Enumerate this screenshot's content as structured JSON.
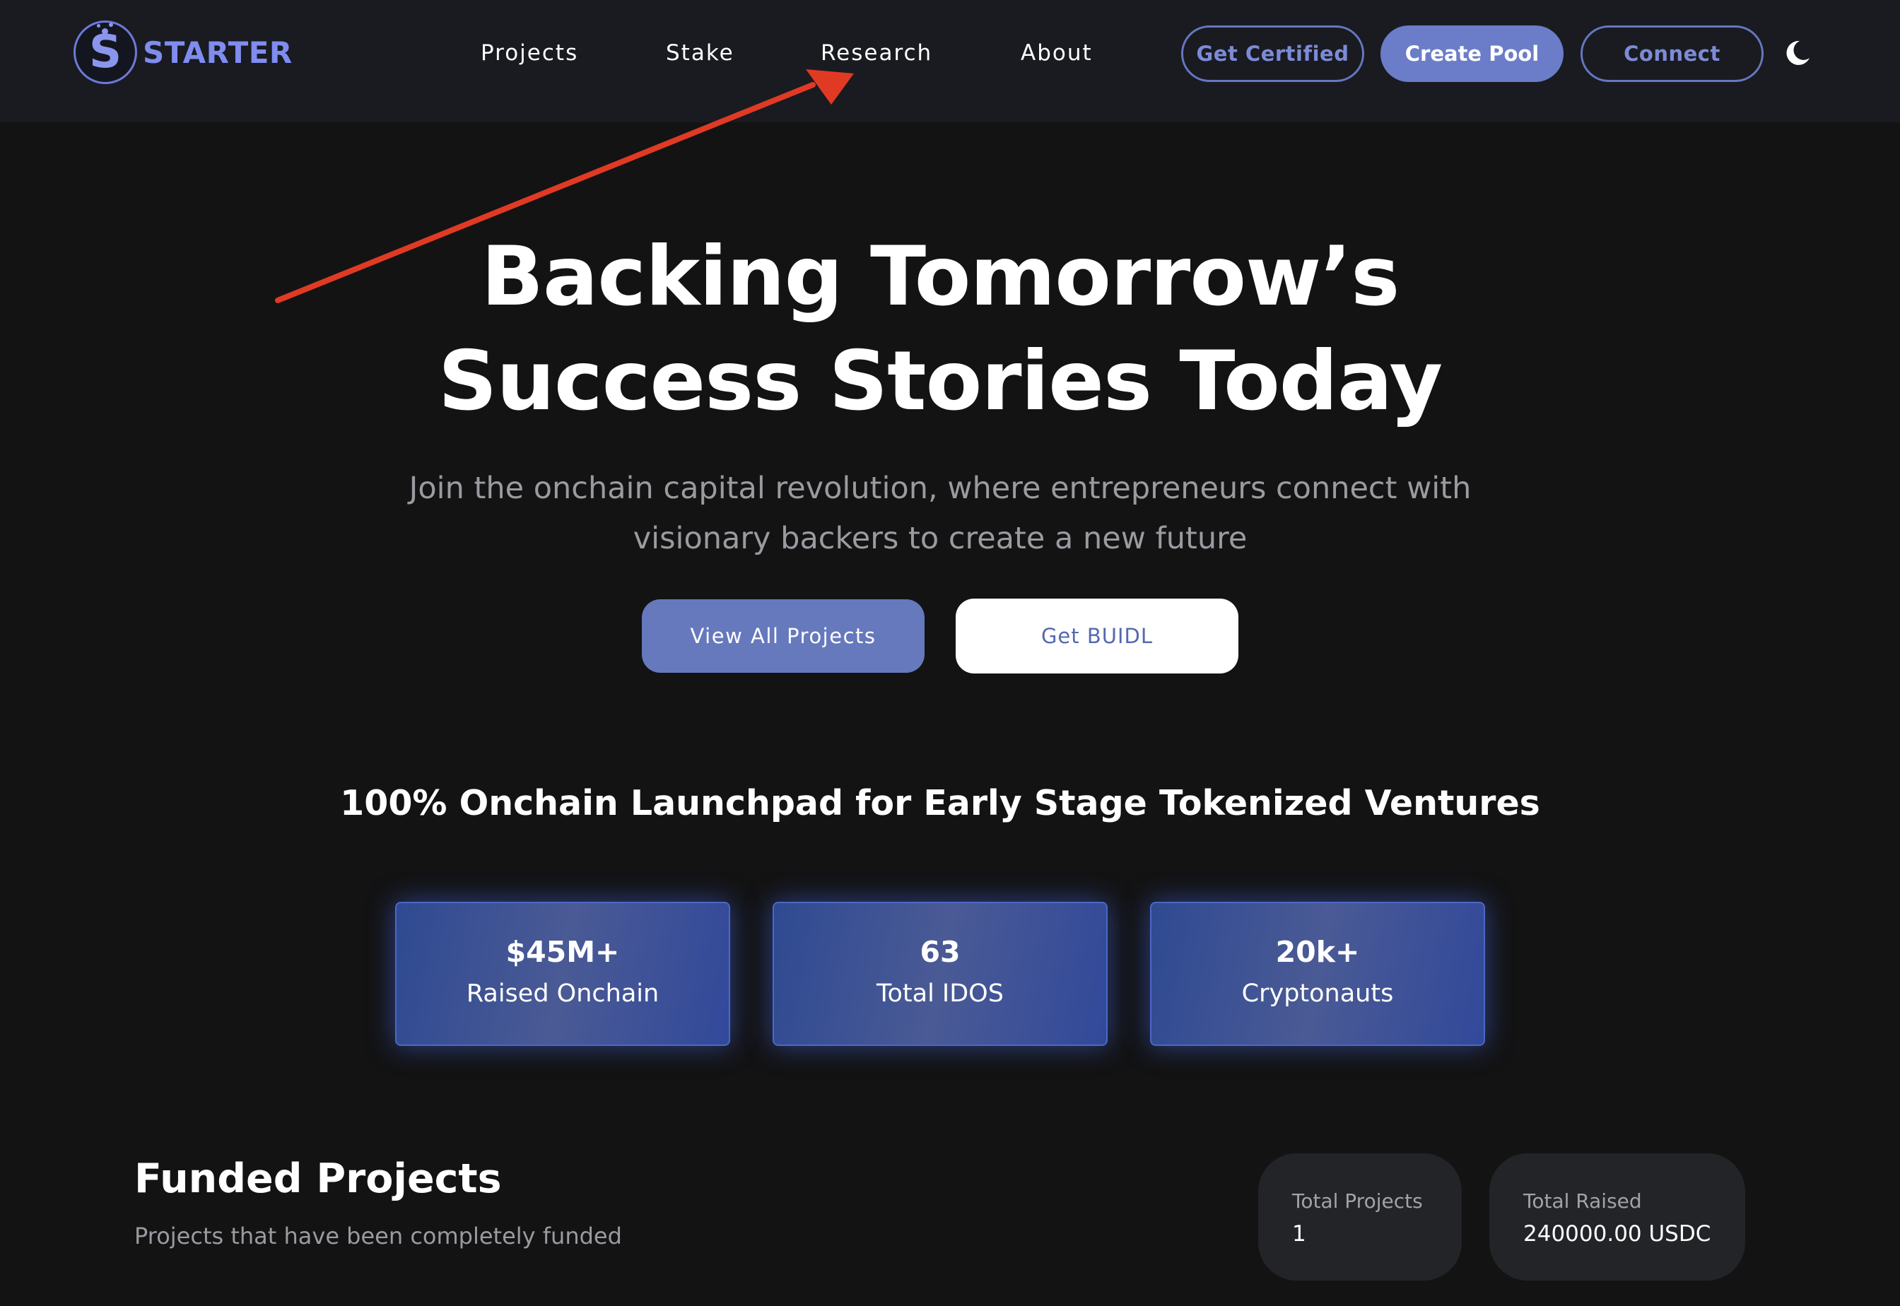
{
  "brand": {
    "name": "STARTER",
    "logo_letter": "S",
    "accent_color": "#7f8cf0"
  },
  "nav": {
    "links": [
      {
        "label": "Projects"
      },
      {
        "label": "Stake"
      },
      {
        "label": "Research"
      },
      {
        "label": "About"
      }
    ],
    "get_certified_label": "Get Certified",
    "create_pool_label": "Create Pool",
    "connect_label": "Connect",
    "theme_icon": "moon-icon"
  },
  "annotation": {
    "type": "arrow",
    "color": "#e03a24",
    "target": "Research"
  },
  "hero": {
    "title_line1": "Backing Tomorrow’s",
    "title_line2": "Success Stories Today",
    "subtitle_line1": "Join the onchain capital revolution, where entrepreneurs connect with",
    "subtitle_line2": "visionary backers to create a new future",
    "primary_button": "View All Projects",
    "secondary_button": "Get BUIDL"
  },
  "launchpad": {
    "heading": "100% Onchain Launchpad for Early Stage Tokenized Ventures"
  },
  "stats": [
    {
      "value": "$45M+",
      "label": "Raised Onchain"
    },
    {
      "value": "63",
      "label": "Total IDOS"
    },
    {
      "value": "20k+",
      "label": "Cryptonauts"
    }
  ],
  "funded": {
    "title": "Funded Projects",
    "subtitle": "Projects that have been completely funded",
    "total_projects_label": "Total Projects",
    "total_projects_value": "1",
    "total_raised_label": "Total Raised",
    "total_raised_value": "240000.00 USDC"
  },
  "colors": {
    "background": "#131314",
    "navbar": "#191b21",
    "button_primary": "#6679bd",
    "card_glow": "#4668e6"
  }
}
